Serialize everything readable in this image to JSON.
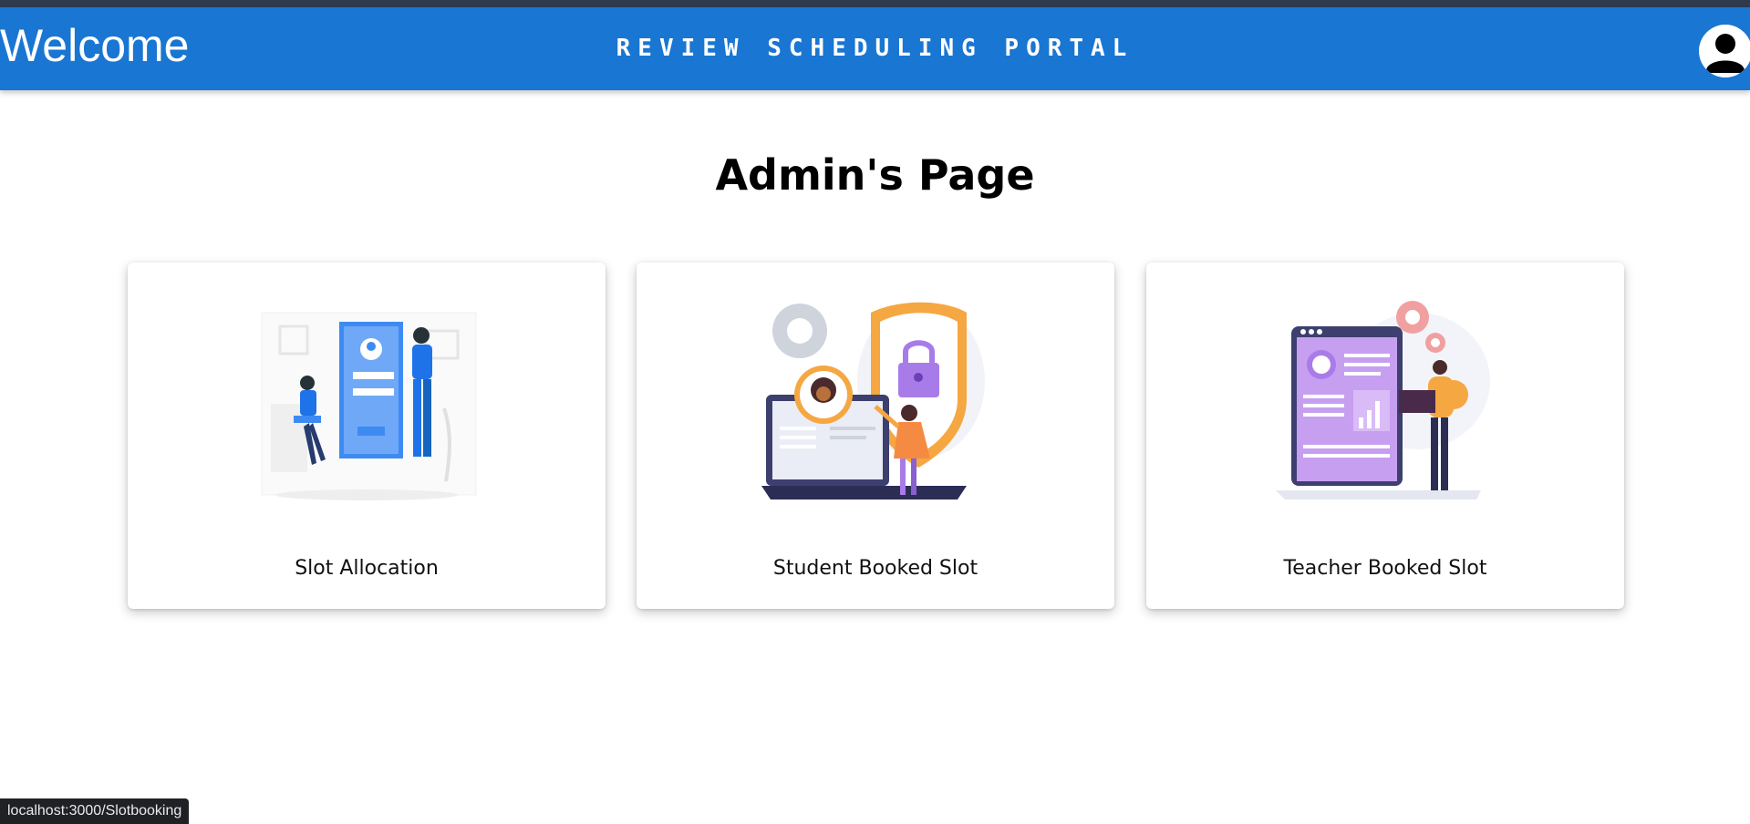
{
  "header": {
    "welcome": "Welcome",
    "portal_title": "REVIEW SCHEDULING PORTAL",
    "avatar_icon": "user-avatar-icon"
  },
  "main": {
    "page_title": "Admin's Page",
    "cards": [
      {
        "label": "Slot Allocation",
        "illustration": "login-form-illustration"
      },
      {
        "label": "Student Booked Slot",
        "illustration": "security-lock-illustration"
      },
      {
        "label": "Teacher Booked Slot",
        "illustration": "dashboard-report-illustration"
      }
    ]
  },
  "status_bar": {
    "url": "localhost:3000/Slotbooking"
  },
  "colors": {
    "navbar": "#1976d2",
    "top_strip": "#2f3a4e",
    "accent_purple": "#a87ce8",
    "accent_orange": "#f5a742"
  }
}
